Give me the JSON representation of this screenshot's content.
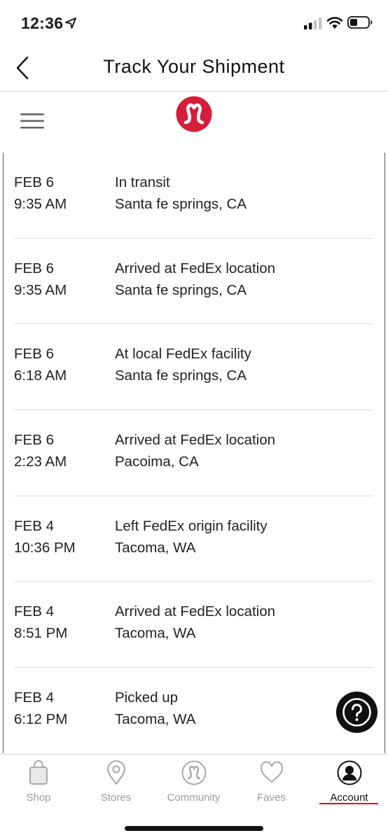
{
  "status_bar": {
    "time": "12:36",
    "icons": [
      "location-arrow-icon",
      "cellular-signal-icon",
      "wifi-icon",
      "battery-icon"
    ]
  },
  "nav": {
    "title": "Track Your Shipment",
    "back_icon": "chevron-left-icon"
  },
  "brand": {
    "menu_icon": "hamburger-menu-icon",
    "logo": "lululemon-logo",
    "brand_color": "#d31f3c"
  },
  "events": [
    {
      "date": "FEB 6",
      "time": "9:35 AM",
      "status": "In transit",
      "location": "Santa fe springs, CA"
    },
    {
      "date": "FEB 6",
      "time": "9:35 AM",
      "status": "Arrived at FedEx location",
      "location": "Santa fe springs, CA"
    },
    {
      "date": "FEB 6",
      "time": "6:18 AM",
      "status": "At local FedEx facility",
      "location": "Santa fe springs, CA"
    },
    {
      "date": "FEB 6",
      "time": "2:23 AM",
      "status": "Arrived at FedEx location",
      "location": "Pacoima, CA"
    },
    {
      "date": "FEB 4",
      "time": "10:36 PM",
      "status": "Left FedEx origin facility",
      "location": "Tacoma, WA"
    },
    {
      "date": "FEB 4",
      "time": "8:51 PM",
      "status": "Arrived at FedEx location",
      "location": "Tacoma, WA"
    },
    {
      "date": "FEB 4",
      "time": "6:12 PM",
      "status": "Picked up",
      "location": "Tacoma, WA"
    }
  ],
  "help": {
    "icon": "help-question-icon"
  },
  "tabs": [
    {
      "label": "Shop",
      "icon": "shopping-bag-icon",
      "active": false
    },
    {
      "label": "Stores",
      "icon": "map-pin-icon",
      "active": false
    },
    {
      "label": "Community",
      "icon": "lululemon-logo-icon",
      "active": false
    },
    {
      "label": "Faves",
      "icon": "heart-icon",
      "active": false
    },
    {
      "label": "Account",
      "icon": "account-icon",
      "active": true
    }
  ],
  "colors": {
    "accent": "#d6002a",
    "text": "#222222",
    "inactive_tab": "#9b9b9b",
    "divider": "#dcdcdc"
  }
}
